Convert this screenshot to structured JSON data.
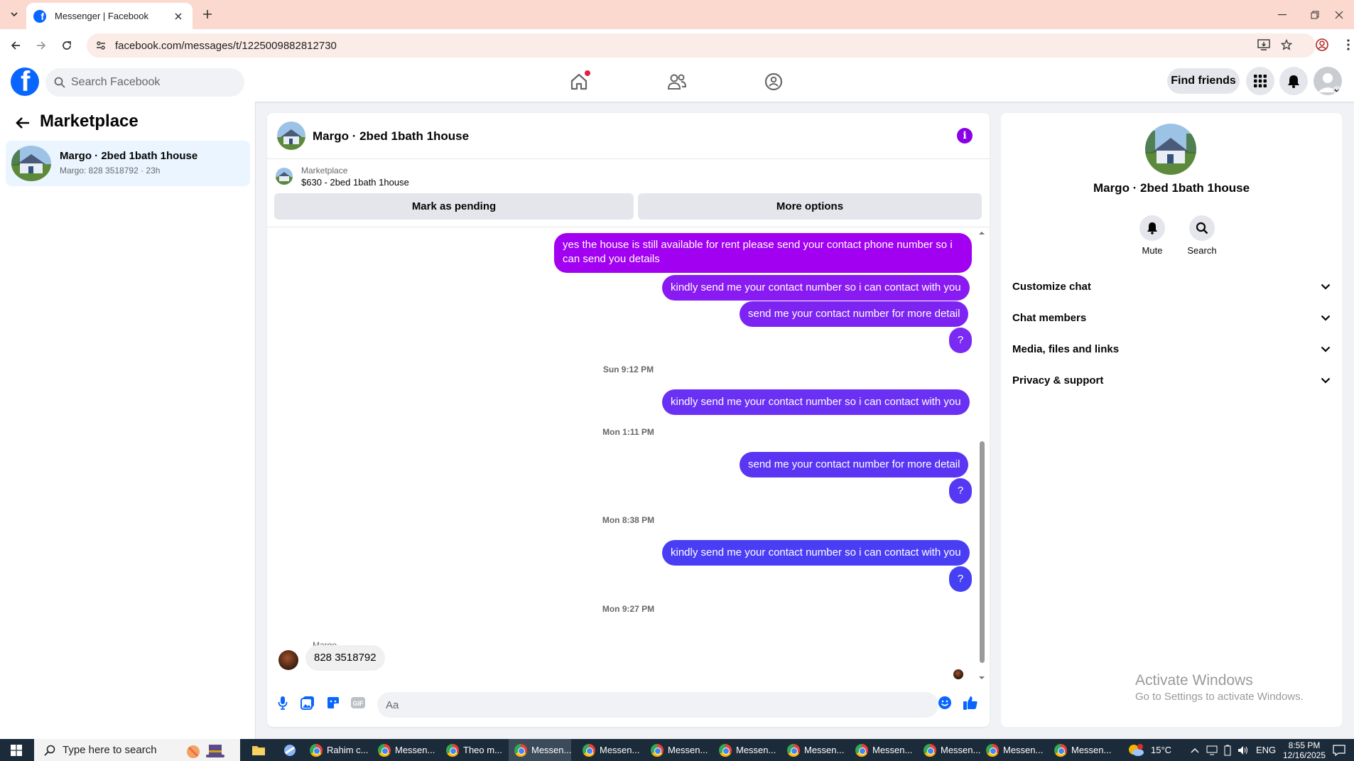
{
  "browser": {
    "tab_title": "Messenger | Facebook",
    "url": "facebook.com/messages/t/1225009882812730"
  },
  "header": {
    "search_placeholder": "Search Facebook",
    "find_friends": "Find friends"
  },
  "sidebar": {
    "title": "Marketplace",
    "conversations": [
      {
        "name": "Margo · 2bed 1bath 1house",
        "preview": "Margo: 828 3518792 · 23h"
      }
    ]
  },
  "chat": {
    "title": "Margo · 2bed 1bath 1house",
    "marketplace_label": "Marketplace",
    "listing": "$630 - 2bed 1bath 1house",
    "mark_pending": "Mark as pending",
    "more_options": "More options",
    "messages": [
      {
        "line1": "yes the house is still available for rent please send your contact phone number so i",
        "line2": "can send you details"
      },
      {
        "text": "kindly send me your contact number so i can contact with you"
      },
      {
        "text": "send me your contact number for more detail"
      },
      {
        "text": "?"
      },
      {
        "stamp": "Sun 9:12 PM"
      },
      {
        "text": "kindly send me your contact number so i can contact with you"
      },
      {
        "stamp": "Mon 1:11 PM"
      },
      {
        "text": "send me your contact number for more detail"
      },
      {
        "text": "?"
      },
      {
        "stamp": "Mon 8:38 PM"
      },
      {
        "text": "kindly send me your contact number so i can contact with you"
      },
      {
        "text": "?"
      },
      {
        "stamp": "Mon 9:27 PM"
      }
    ],
    "incoming_sender": "Margo",
    "incoming_text": "828 3518792",
    "composer_placeholder": "Aa"
  },
  "details": {
    "title": "Margo · 2bed 1bath 1house",
    "mute": "Mute",
    "search": "Search",
    "sections": [
      "Customize chat",
      "Chat members",
      "Media, files and links",
      "Privacy & support"
    ]
  },
  "watermark": {
    "line1": "Activate Windows",
    "line2": "Go to Settings to activate Windows."
  },
  "taskbar": {
    "search_placeholder": "Type here to search",
    "apps": [
      "Rahim c...",
      "Messen...",
      "Theo m...",
      "Messen...",
      "Messen...",
      "Messen...",
      "Messen...",
      "Messen...",
      "Messen...",
      "Messen...",
      "Messen...",
      "Messen..."
    ],
    "temperature": "15°C",
    "language": "ENG",
    "time": "8:55 PM",
    "date": "12/16/2025"
  },
  "colors": {
    "fb_blue": "#0866ff",
    "bubble_purple": "#a000f0",
    "bubble_violet": "#7a2af0",
    "bubble_blue": "#4a3ef5"
  }
}
